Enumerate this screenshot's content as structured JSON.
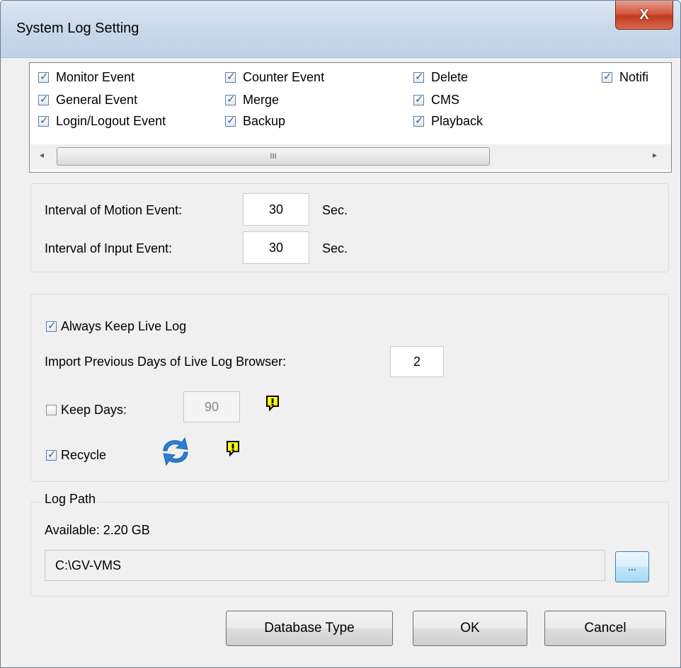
{
  "window": {
    "title": "System Log Setting",
    "close_label": "X"
  },
  "event_list": {
    "items": [
      {
        "label": "Monitor Event",
        "checked": true
      },
      {
        "label": "General Event",
        "checked": true
      },
      {
        "label": "Login/Logout Event",
        "checked": true
      },
      {
        "label": "Counter Event",
        "checked": true
      },
      {
        "label": "Merge",
        "checked": true
      },
      {
        "label": "Backup",
        "checked": true
      },
      {
        "label": "Delete",
        "checked": true
      },
      {
        "label": "CMS",
        "checked": true
      },
      {
        "label": "Playback",
        "checked": true
      },
      {
        "label": "Notifi",
        "checked": true
      }
    ],
    "scroll_left": "◂",
    "scroll_right": "▸",
    "thumb_grip": "III"
  },
  "intervals": {
    "motion_label": "Interval of Motion Event:",
    "motion_value": "30",
    "input_label": "Interval of Input Event:",
    "input_value": "30",
    "unit": "Sec."
  },
  "live_log": {
    "always_keep_label": "Always Keep Live Log",
    "always_keep_checked": true,
    "import_label": "Import Previous Days of Live Log Browser:",
    "import_value": "2",
    "keep_days_label": "Keep Days:",
    "keep_days_checked": false,
    "keep_days_value": "90",
    "recycle_label": "Recycle",
    "recycle_checked": true,
    "icons": [
      "warning-icon",
      "recycle-icon",
      "warning-icon"
    ]
  },
  "log_path": {
    "group_label": "Log Path",
    "available": "Available: 2.20 GB",
    "path": "C:\\GV-VMS",
    "browse_label": "..."
  },
  "buttons": {
    "database_type": "Database Type",
    "ok": "OK",
    "cancel": "Cancel"
  }
}
